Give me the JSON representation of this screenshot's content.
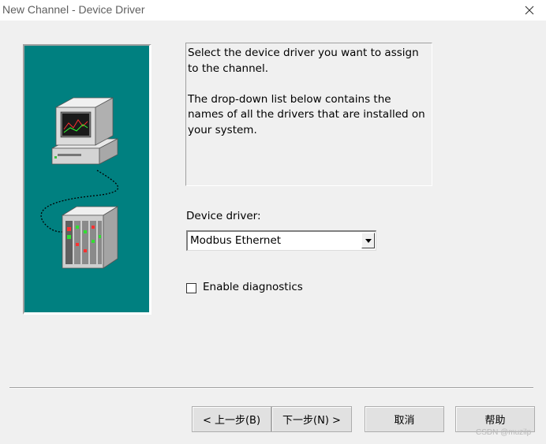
{
  "window": {
    "title": "New Channel - Device Driver",
    "close_icon": "close-icon"
  },
  "description": {
    "line1": "Select the device driver you want to assign to the channel.",
    "line2": "The drop-down list below contains the names of all the drivers that are installed on your system."
  },
  "device_driver": {
    "label": "Device driver:",
    "selected": "Modbus Ethernet"
  },
  "diagnostics": {
    "label": "Enable diagnostics",
    "checked": false
  },
  "buttons": {
    "back": "< 上一步(B)",
    "next": "下一步(N) >",
    "cancel": "取消",
    "help": "帮助"
  },
  "watermark": "CSDN @muzilp",
  "colors": {
    "illustration_bg": "#008080",
    "dialog_bg": "#f0f0f0"
  },
  "icons": [
    "computer-icon",
    "plc-rack-icon",
    "close-icon",
    "dropdown-arrow-icon"
  ]
}
